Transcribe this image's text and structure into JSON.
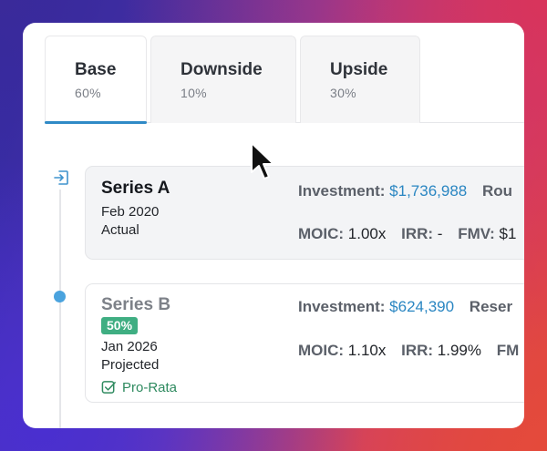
{
  "tabs": [
    {
      "label": "Base",
      "pct": "60%"
    },
    {
      "label": "Downside",
      "pct": "10%"
    },
    {
      "label": "Upside",
      "pct": "30%"
    }
  ],
  "rounds": {
    "a": {
      "name": "Series A",
      "date": "Feb 2020",
      "status": "Actual",
      "investment_label": "Investment:",
      "investment_value": "$1,736,988",
      "extra_label": "Rou",
      "moic_label": "MOIC:",
      "moic_value": "1.00x",
      "irr_label": "IRR:",
      "irr_value": "-",
      "fmv_label": "FMV:",
      "fmv_value": "$1"
    },
    "b": {
      "name": "Series B",
      "badge": "50%",
      "date": "Jan 2026",
      "status": "Projected",
      "prorata": "Pro-Rata",
      "investment_label": "Investment:",
      "investment_value": "$624,390",
      "extra_label": "Reser",
      "moic_label": "MOIC:",
      "moic_value": "1.10x",
      "irr_label": "IRR:",
      "irr_value": "1.99%",
      "fmv_label": "FM"
    }
  },
  "colors": {
    "accent": "#2f8ac6",
    "link_value": "#2a86c2",
    "badge_green": "#3fae82",
    "timeline_dot": "#4aa3de"
  },
  "icons": [
    "enter-icon",
    "checkbox-checked-icon",
    "mouse-cursor-icon"
  ]
}
